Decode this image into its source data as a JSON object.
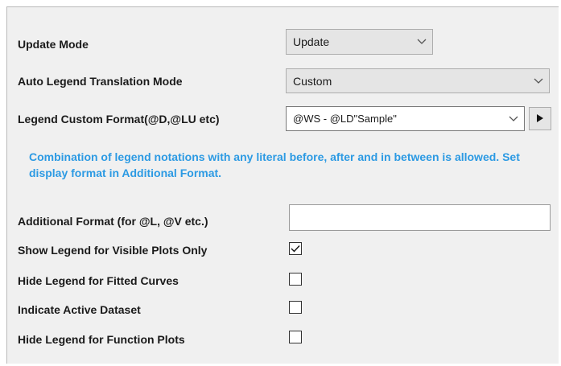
{
  "update_mode": {
    "label": "Update Mode",
    "value": "Update",
    "icon": "chevron-down-icon"
  },
  "translation_mode": {
    "label": "Auto Legend Translation Mode",
    "value": "Custom",
    "icon": "chevron-down-icon"
  },
  "custom_format": {
    "label": "Legend Custom Format(@D,@LU etc)",
    "value": "@WS - @LD\"Sample\"",
    "icon": "chevron-down-icon",
    "button_icon": "play-arrow-icon"
  },
  "hint": "Combination of legend notations with any literal before, after and in between is allowed. Set display format in Additional Format.",
  "additional_format": {
    "label": "Additional Format (for @L, @V etc.)",
    "value": ""
  },
  "options": [
    {
      "label": "Show Legend for Visible Plots Only",
      "checked": true
    },
    {
      "label": "Hide Legend for Fitted Curves",
      "checked": false
    },
    {
      "label": "Indicate Active Dataset",
      "checked": false
    },
    {
      "label": "Hide Legend for Function Plots",
      "checked": false
    }
  ],
  "colors": {
    "hint": "#2c9ae3",
    "panel_bg": "#f0f0f0",
    "dropdown_bg": "#e5e5e5"
  }
}
